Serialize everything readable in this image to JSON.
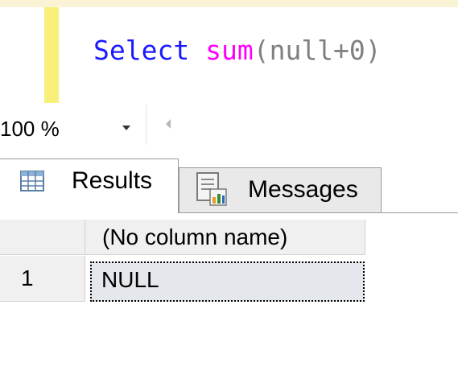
{
  "editor": {
    "code_parts": {
      "keyword": "Select",
      "function": "sum",
      "paren_open": "(",
      "literal": "null+0",
      "paren_close": ")"
    }
  },
  "zoom": {
    "value": "100 %"
  },
  "tabs": [
    {
      "label": "Results",
      "icon": "grid-icon",
      "active": true
    },
    {
      "label": "Messages",
      "icon": "messages-icon",
      "active": false
    }
  ],
  "results": {
    "columns": [
      "(No column name)"
    ],
    "rows": [
      {
        "num": "1",
        "cells": [
          "NULL"
        ]
      }
    ]
  },
  "colors": {
    "keyword": "#1a1aff",
    "function": "#ff00ff",
    "operator": "#808080",
    "selection_cell": "#e4e8ec"
  }
}
